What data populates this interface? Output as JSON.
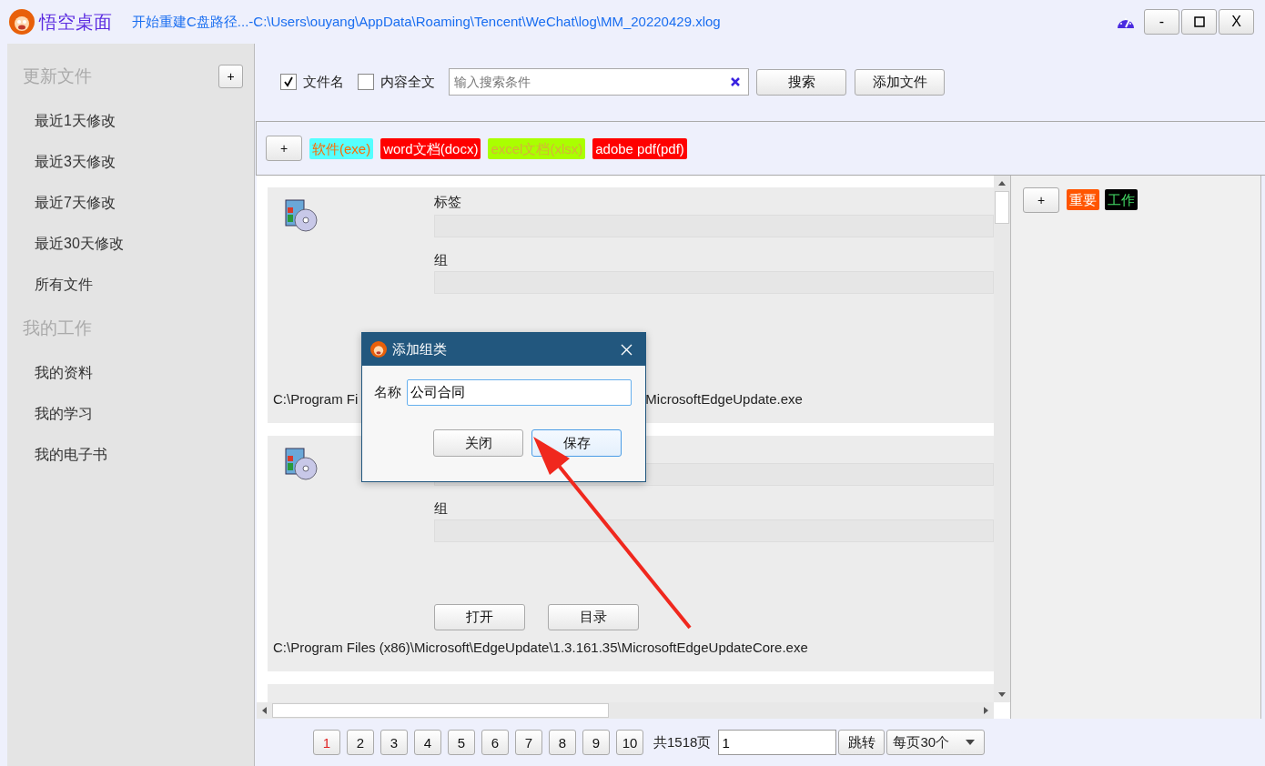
{
  "app": {
    "title": "悟空桌面",
    "status": "开始重建C盘路径...-C:\\Users\\ouyang\\AppData\\Roaming\\Tencent\\WeChat\\log\\MM_20220429.xlog"
  },
  "window_buttons": [
    {
      "kind": "text",
      "label": "-"
    },
    {
      "kind": "maximize"
    },
    {
      "kind": "text",
      "label": "X"
    }
  ],
  "sidebar": {
    "sections": [
      {
        "title": "更新文件",
        "add_button": "+",
        "items": [
          "最近1天修改",
          "最近3天修改",
          "最近7天修改",
          "最近30天修改",
          "所有文件"
        ]
      },
      {
        "title": "我的工作",
        "items": [
          "我的资料",
          "我的学习",
          "我的电子书"
        ]
      }
    ]
  },
  "search": {
    "checkboxes": [
      {
        "label": "文件名",
        "checked": true
      },
      {
        "label": "内容全文",
        "checked": false
      }
    ],
    "placeholder": "输入搜索条件",
    "buttons": [
      "搜索",
      "添加文件"
    ]
  },
  "type_tags": {
    "add_button": "+",
    "tags": [
      {
        "label": "软件(exe)",
        "color": "#55ffff"
      },
      {
        "label": "word文档(docx)",
        "color": "#ff0000"
      },
      {
        "label": "excel文档(xlsx)",
        "color": "#aaff00"
      },
      {
        "label": "adobe pdf(pdf)",
        "color": "#ff0000"
      }
    ]
  },
  "cards": [
    {
      "kind": "file",
      "tag_label": "标签",
      "group_label": "组",
      "path_parts": [
        "C:\\Program Fi",
        "MicrosoftEdgeUpdate.exe"
      ]
    },
    {
      "kind": "file",
      "group_label": "组",
      "buttons": [
        "打开",
        "目录"
      ],
      "path_parts": [
        "C:\\Program Files (x86)\\Microsoft\\EdgeUpdate\\1.3.161.35\\MicrosoftEdgeUpdateCore.exe"
      ]
    },
    {
      "kind": "partial"
    }
  ],
  "right_tags": {
    "add_button": "+",
    "tags": [
      {
        "label": "重要",
        "color": "#ff5500"
      },
      {
        "label": "工作",
        "color": "#000000"
      }
    ]
  },
  "pagination": {
    "pages": [
      {
        "label": "1",
        "selected": true
      },
      {
        "label": "2",
        "selected": false
      },
      {
        "label": "3",
        "selected": false
      },
      {
        "label": "4",
        "selected": false
      },
      {
        "label": "5",
        "selected": false
      },
      {
        "label": "6",
        "selected": false
      },
      {
        "label": "7",
        "selected": false
      },
      {
        "label": "8",
        "selected": false
      },
      {
        "label": "9",
        "selected": false
      },
      {
        "label": "10",
        "selected": false
      }
    ],
    "total": "共1518页",
    "jump_value": "1",
    "jump_button": "跳转",
    "page_size": "每页30个"
  },
  "dialog": {
    "title": "添加组类",
    "field_label": "名称",
    "value": "公司合同",
    "buttons": [
      {
        "label": "关闭",
        "default": false
      },
      {
        "label": "保存",
        "default": true
      }
    ]
  }
}
